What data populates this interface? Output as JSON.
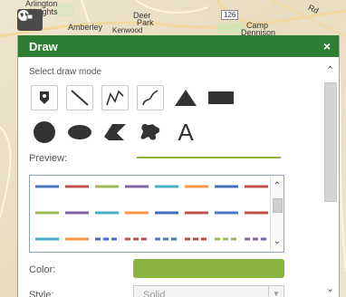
{
  "map": {
    "labels": [
      "Arlington",
      "Heights",
      "Deer",
      "Park",
      "Amberley",
      "Kenwood",
      "126",
      "Camp",
      "Dennison",
      "Rd"
    ]
  },
  "panel": {
    "title": "Draw",
    "close_label": "×",
    "select_draw_mode_label": "Select draw mode",
    "tools": [
      {
        "name": "point",
        "icon": "pin-icon"
      },
      {
        "name": "line",
        "icon": "line-icon"
      },
      {
        "name": "polyline",
        "icon": "polyline-icon"
      },
      {
        "name": "freehand-polyline",
        "icon": "freehand-line-icon"
      },
      {
        "name": "triangle",
        "icon": "triangle-icon"
      },
      {
        "name": "rectangle",
        "icon": "rectangle-icon"
      },
      {
        "name": "circle",
        "icon": "circle-icon"
      },
      {
        "name": "ellipse",
        "icon": "ellipse-icon"
      },
      {
        "name": "polygon",
        "icon": "polygon-icon"
      },
      {
        "name": "freehand-polygon",
        "icon": "freehand-polygon-icon"
      },
      {
        "name": "text",
        "icon": "text-icon",
        "glyph": "A"
      }
    ],
    "preview_label": "Preview:",
    "color_label": "Color:",
    "color_value": "#8ab33f",
    "style_label": "Style:",
    "style_value": "Solid"
  },
  "line_style_palette": [
    "#4a78c2",
    "#c0504d",
    "#9bbb59",
    "#8064a2",
    "#4bacc6",
    "#f79646",
    "#3f6fbe",
    "#c0504d"
  ]
}
